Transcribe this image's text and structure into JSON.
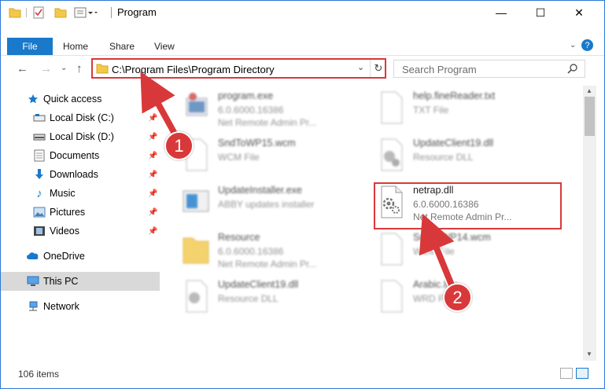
{
  "window": {
    "title": "Program",
    "controls": {
      "minimize": "—",
      "maximize": "☐",
      "close": "✕"
    }
  },
  "ribbon": {
    "tabs": [
      {
        "label": "File",
        "active": true
      },
      {
        "label": "Home"
      },
      {
        "label": "Share"
      },
      {
        "label": "View"
      }
    ]
  },
  "address": {
    "path": "C:\\Program Files\\Program Directory"
  },
  "search": {
    "placeholder": "Search Program"
  },
  "nav": {
    "items": [
      {
        "label": "Quick access",
        "icon": "star-icon"
      },
      {
        "label": "Local Disk (C:)",
        "icon": "drive-icon",
        "pinned": true
      },
      {
        "label": "Local Disk (D:)",
        "icon": "drive-icon",
        "pinned": true
      },
      {
        "label": "Documents",
        "icon": "documents-icon",
        "pinned": true
      },
      {
        "label": "Downloads",
        "icon": "download-icon",
        "pinned": true
      },
      {
        "label": "Music",
        "icon": "music-icon",
        "pinned": true
      },
      {
        "label": "Pictures",
        "icon": "pictures-icon",
        "pinned": true
      },
      {
        "label": "Videos",
        "icon": "videos-icon",
        "pinned": true
      },
      {
        "label": "OneDrive",
        "icon": "cloud-icon"
      },
      {
        "label": "This PC",
        "icon": "computer-icon",
        "selected": true
      },
      {
        "label": "Network",
        "icon": "network-icon"
      }
    ]
  },
  "files": [
    {
      "name": "program.exe",
      "line1": "6.0.6000.16386",
      "line2": "Net Remote Admin Pr...",
      "icon": "exe-icon",
      "blurred": true
    },
    {
      "name": "help.fineReader.txt",
      "line1": "TXT File",
      "line2": "",
      "icon": "txt-file-icon",
      "blurred": true
    },
    {
      "name": "SndToWP15.wcm",
      "line1": "WCM File",
      "line2": "",
      "icon": "file-icon",
      "blurred": true
    },
    {
      "name": "UpdateClient19.dll",
      "line1": "Resource DLL",
      "line2": "",
      "icon": "dll-icon",
      "blurred": true
    },
    {
      "name": "UpdateInstaller.exe",
      "line1": "ABBY updates installer",
      "line2": "",
      "icon": "installer-icon",
      "blurred": true
    },
    {
      "name": "netrap.dll",
      "line1": "6.0.6000.16386",
      "line2": "Net Remote Admin Pr...",
      "icon": "dll-icon",
      "blurred": false,
      "highlighted": true
    },
    {
      "name": "Resource",
      "line1": "6.0.6000.16386",
      "line2": "Net Remote Admin Pr...",
      "icon": "folder-icon",
      "blurred": true
    },
    {
      "name": "SndToWP14.wcm",
      "line1": "WCM File",
      "line2": "",
      "icon": "file-icon",
      "blurred": true
    },
    {
      "name": "UpdateClient19.dll",
      "line1": "Resource DLL",
      "line2": "",
      "icon": "dll-icon",
      "blurred": true
    },
    {
      "name": "Arabic.lng",
      "line1": "WRD File",
      "line2": "",
      "icon": "file-icon",
      "blurred": true
    }
  ],
  "status": {
    "item_count": "106 items"
  },
  "annotations": {
    "callout1": "1",
    "callout2": "2",
    "color": "#d9383a"
  },
  "colors": {
    "accent": "#1979ca",
    "highlight": "#d9383a"
  }
}
